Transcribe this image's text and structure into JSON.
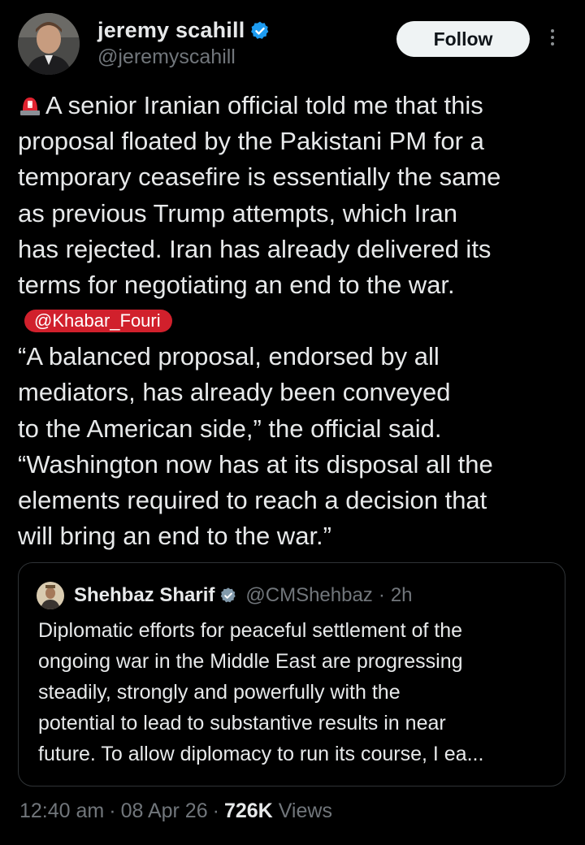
{
  "author": {
    "name": "jeremy scahill",
    "handle": "@jeremyscahill",
    "verified_icon": "verified-badge-icon",
    "avatar": "avatar"
  },
  "actions": {
    "follow_label": "Follow",
    "more_icon": "more-options-icon"
  },
  "tweet": {
    "emoji_icon": "police-siren-icon",
    "lines": [
      "A senior Iranian official told me that this",
      "proposal floated by the Pakistani PM for a",
      "temporary ceasefire is essentially the same",
      "as previous Trump attempts, which Iran",
      "has rejected. Iran has already delivered its",
      "terms for negotiating an end to the war."
    ],
    "mention": "@Khabar_Fouri",
    "quote_lines": [
      "“A balanced proposal, endorsed by all",
      "mediators, has already been conveyed",
      "to the American side,” the official said.",
      "“Washington now has at its disposal all the",
      "elements required to reach a decision that",
      "will bring an end to the war.”"
    ]
  },
  "quoted_tweet": {
    "name": "Shehbaz Sharif",
    "handle": "@CMShehbaz",
    "separator": "·",
    "time": "2h",
    "lines": [
      "Diplomatic efforts for peaceful settlement of the",
      "ongoing war in the Middle East are progressing",
      "steadily, strongly and powerfully with the",
      "potential to lead to substantive results in near",
      "future. To allow diplomacy to run its course, I ea..."
    ]
  },
  "meta": {
    "time": "12:40 am",
    "separator": "·",
    "date": "08 Apr 26",
    "views_count": "726K",
    "views_label": "Views"
  },
  "colors": {
    "background": "#000000",
    "text": "#e7e9ea",
    "muted": "#71767b",
    "verified_blue": "#1d9bf0",
    "mention_red": "#d1202c",
    "border": "#2f3336"
  }
}
